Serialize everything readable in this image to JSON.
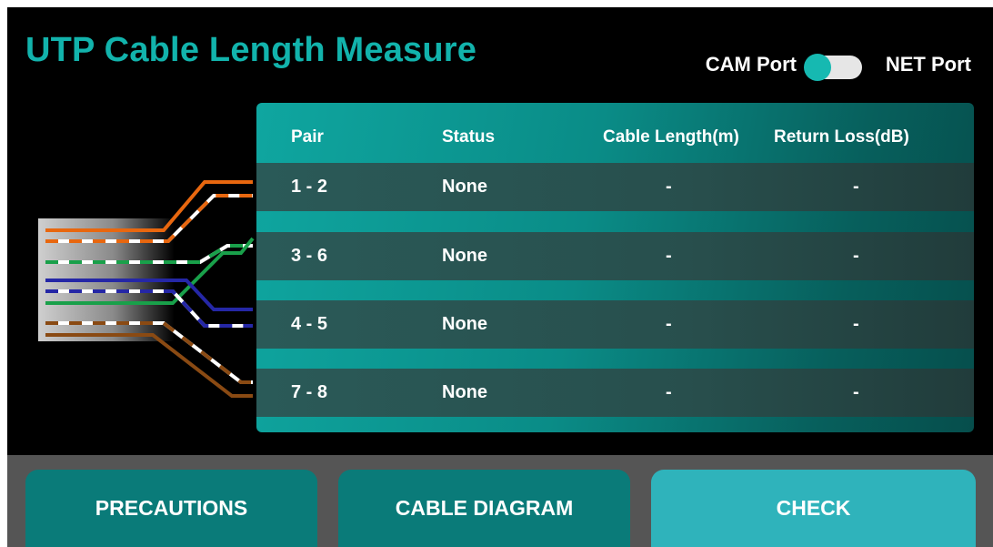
{
  "header": {
    "title": "UTP Cable Length Measure",
    "cam_port_label": "CAM Port",
    "net_port_label": "NET Port",
    "toggle_state": "CAM Port"
  },
  "table": {
    "headers": {
      "pair": "Pair",
      "status": "Status",
      "length": "Cable Length(m)",
      "loss": "Return Loss(dB)"
    },
    "rows": [
      {
        "pair": "1 - 2",
        "status": "None",
        "length": "-",
        "loss": "-"
      },
      {
        "pair": "3 - 6",
        "status": "None",
        "length": "-",
        "loss": "-"
      },
      {
        "pair": "4 - 5",
        "status": "None",
        "length": "-",
        "loss": "-"
      },
      {
        "pair": "7 - 8",
        "status": "None",
        "length": "-",
        "loss": "-"
      }
    ]
  },
  "buttons": {
    "precautions": "PRECAUTIONS",
    "diagram": "CABLE DIAGRAM",
    "check": "CHECK"
  },
  "colors": {
    "accent": "#12b3ac",
    "table_gradient_start": "#0fa6a0",
    "table_gradient_end": "#064e4c",
    "row_bg": "#284f4d",
    "button_bg": "#0a7b79",
    "check_button_bg": "#2fb3bb",
    "bottom_bar": "#555555",
    "wire_orange": "#e8670f",
    "wire_green": "#19a04a",
    "wire_blue": "#2527a6",
    "wire_brown": "#8a4a13"
  }
}
